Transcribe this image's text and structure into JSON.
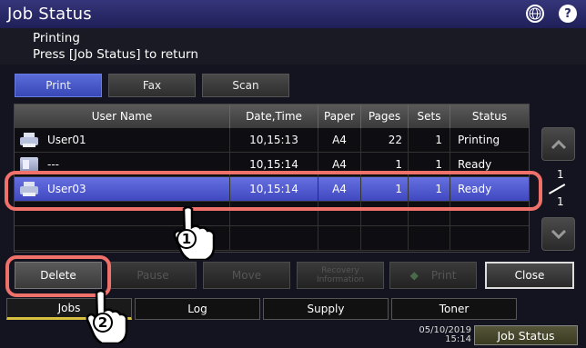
{
  "title": "Job Status",
  "message": {
    "line1": "Printing",
    "line2": "Press [Job Status] to return"
  },
  "type_tabs": [
    {
      "label": "Print",
      "active": true
    },
    {
      "label": "Fax",
      "active": false
    },
    {
      "label": "Scan",
      "active": false
    }
  ],
  "table": {
    "headers": [
      "User Name",
      "Date,Time",
      "Paper",
      "Pages",
      "Sets",
      "Status"
    ],
    "rows": [
      {
        "user": "User01",
        "datetime": "10,15:13",
        "paper": "A4",
        "pages": "22",
        "sets": "1",
        "status": "Printing",
        "icon": "printer-icon"
      },
      {
        "user": "---",
        "datetime": "10,15:14",
        "paper": "A4",
        "pages": "1",
        "sets": "1",
        "status": "Ready",
        "icon": "fax-icon"
      },
      {
        "user": "User03",
        "datetime": "10,15:14",
        "paper": "A4",
        "pages": "1",
        "sets": "1",
        "status": "Ready",
        "icon": "printer-icon",
        "selected": true
      }
    ]
  },
  "pagination": {
    "current": "1",
    "total": "1"
  },
  "actions": {
    "delete": "Delete",
    "pause": "Pause",
    "move": "Move",
    "recovery_line1": "Recovery",
    "recovery_line2": "Information",
    "print": "Print",
    "close": "Close"
  },
  "bottom_tabs": [
    {
      "label": "Jobs",
      "active": true
    },
    {
      "label": "Log",
      "active": false
    },
    {
      "label": "Supply",
      "active": false
    },
    {
      "label": "Toner",
      "active": false
    }
  ],
  "status_bar": {
    "date": "05/10/2019",
    "time": "15:14",
    "job_status_button": "Job Status"
  },
  "callouts": {
    "first": "1",
    "second": "2"
  },
  "colors": {
    "highlight": "#f0706a",
    "selected_row": "#5058d0",
    "active_tab": "#4858c8"
  }
}
